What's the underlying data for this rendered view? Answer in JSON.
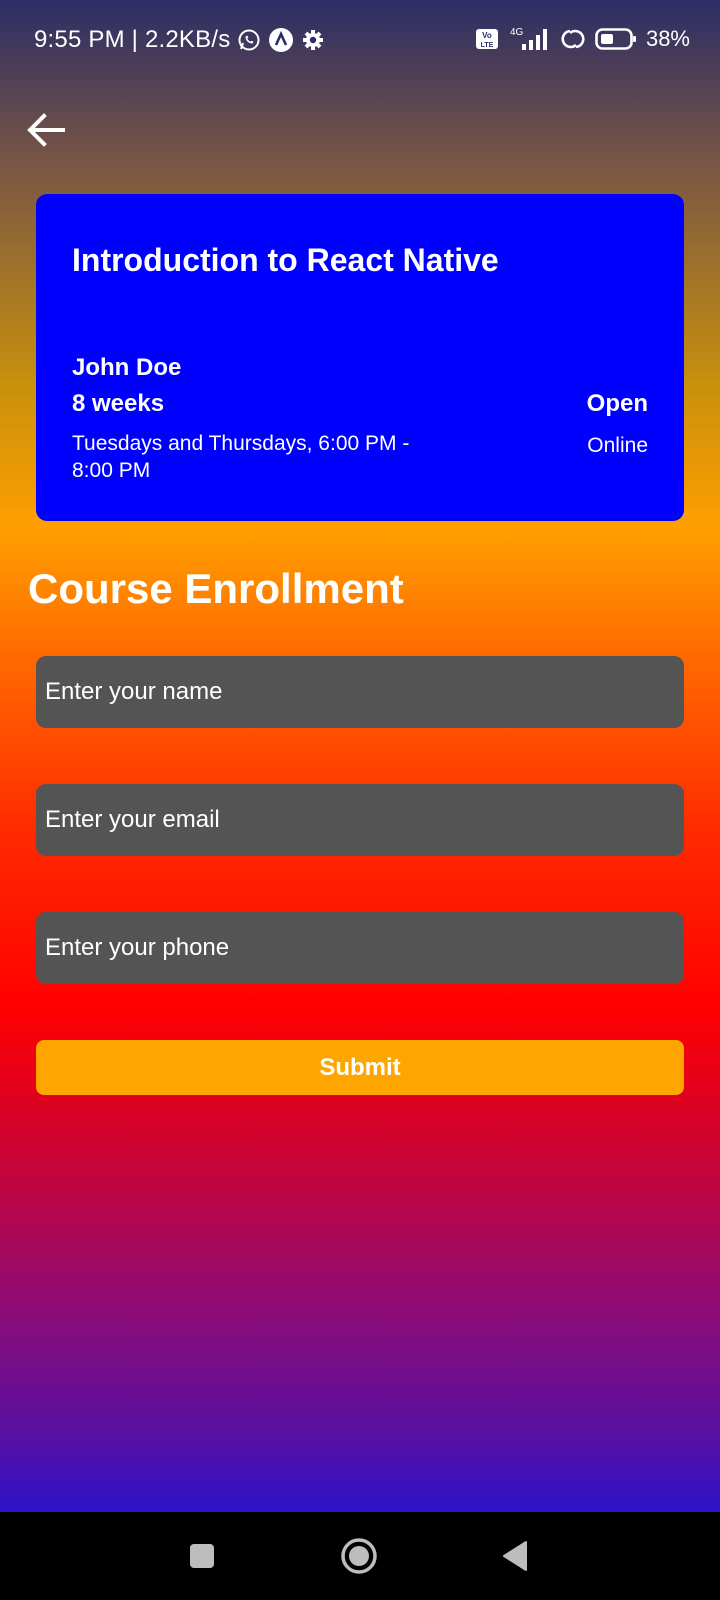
{
  "status_bar": {
    "time": "9:55 PM | 2.2KB/s",
    "battery": "38%",
    "network": "4G",
    "volte": "Vo LTE",
    "icons": [
      "whatsapp-icon",
      "app-notification-icon",
      "settings-icon",
      "volte-icon",
      "signal-icon",
      "sync-icon",
      "battery-icon"
    ]
  },
  "course": {
    "title": "Introduction to React Native",
    "instructor": "John Doe",
    "duration": "8 weeks",
    "schedule": "Tuesdays and Thursdays, 6:00 PM - 8:00 PM",
    "status": "Open",
    "location": "Online"
  },
  "enrollment": {
    "title": "Course Enrollment",
    "name_placeholder": "Enter your name",
    "email_placeholder": "Enter your email",
    "phone_placeholder": "Enter your phone",
    "submit_label": "Submit"
  },
  "colors": {
    "card_background": "#0000ff",
    "input_background": "#545454",
    "submit_background": "#ffa500",
    "text": "#ffffff"
  }
}
